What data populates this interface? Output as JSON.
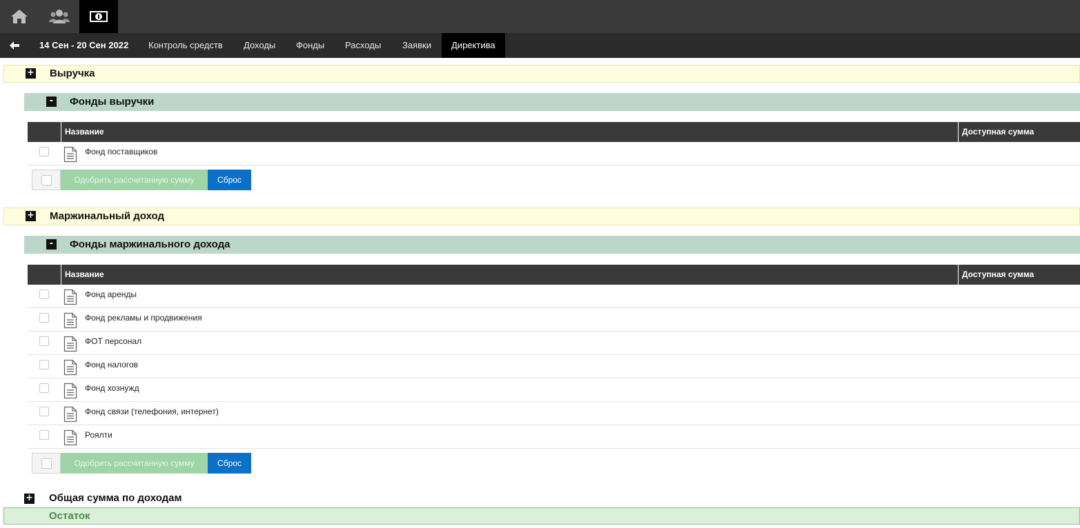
{
  "topbar": {
    "icons": [
      "home-icon",
      "users-icon",
      "money-icon"
    ],
    "active_icon": "money-icon"
  },
  "nav": {
    "back_icon": "arrow-left-icon",
    "date_range": "14 Сен - 20 Сен 2022",
    "items": [
      "Контроль средств",
      "Доходы",
      "Фонды",
      "Расходы",
      "Заявки",
      "Директива"
    ],
    "active": "Директива"
  },
  "sections": {
    "revenue": {
      "title": "Выручка",
      "toggle": "+",
      "funds": {
        "title": "Фонды выручки",
        "toggle": "-",
        "col_name": "Название",
        "col_sum": "Доступная сумма",
        "rows": [
          "Фонд поставщиков"
        ],
        "approve_label": "Одобрить рассчитанную сумму",
        "reset_label": "Сброс"
      }
    },
    "margin": {
      "title": "Маржинальный доход",
      "toggle": "+",
      "funds": {
        "title": "Фонды маржинального дохода",
        "toggle": "-",
        "col_name": "Название",
        "col_sum": "Доступная сумма",
        "rows": [
          "Фонд аренды",
          "Фонд рекламы и продвижения",
          "ФОТ персонал",
          "Фонд налогов",
          "Фонд хознужд",
          "Фонд связи (телефония, интернет)",
          "Роялти"
        ],
        "approve_label": "Одобрить рассчитанную сумму",
        "reset_label": "Сброс"
      }
    },
    "total": {
      "title": "Общая сумма по доходам",
      "toggle": "+"
    },
    "rest": {
      "title": "Остаток"
    }
  },
  "colors": {
    "topbar": "#3a3a3a",
    "navbar": "#2b2b2b",
    "section_yellow": "#fefdde",
    "section_green": "#bcd6cb",
    "approve_button": "#9ed4a6",
    "reset_button": "#0b71c8",
    "rest_bg": "#dcefd9",
    "rest_text": "#4a8a4a"
  }
}
